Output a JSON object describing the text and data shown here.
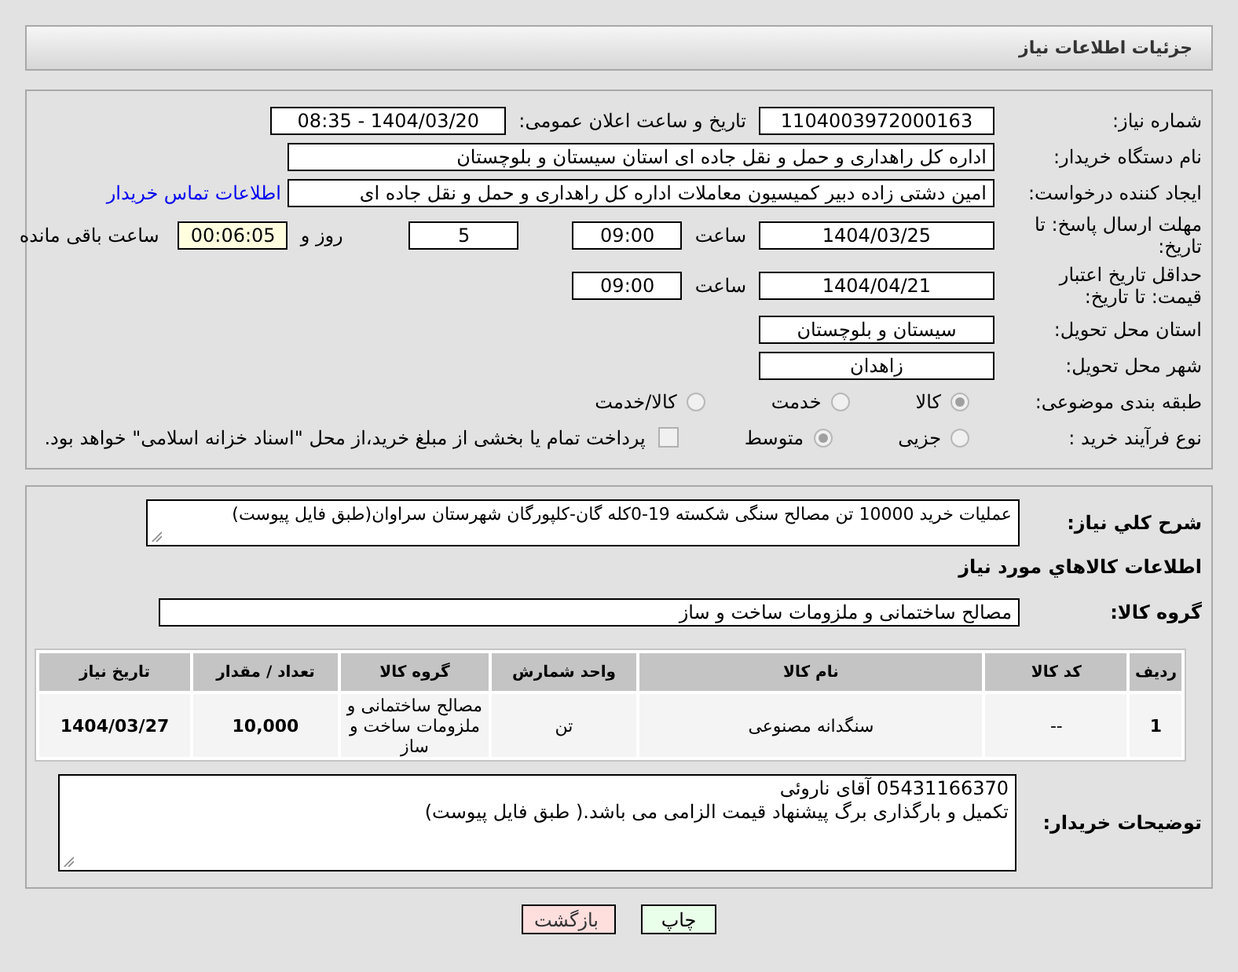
{
  "header": {
    "title": "جزئیات اطلاعات نیاز"
  },
  "details": [
    {
      "label": "شماره نیاز:",
      "items": [
        {
          "kind": "field",
          "value": "1104003972000163"
        },
        {
          "kind": "text",
          "value": "تاریخ و ساعت اعلان عمومی:"
        },
        {
          "kind": "field",
          "value": "1404/03/20 - 08:35"
        }
      ]
    },
    {
      "label": "نام دستگاه خریدار:",
      "items": [
        {
          "kind": "long-field",
          "value": "اداره کل راهداری و حمل و نقل جاده ای استان سیستان و بلوچستان"
        }
      ]
    },
    {
      "label": "ایجاد کننده درخواست:",
      "items": [
        {
          "kind": "long-field",
          "value": "امین دشتی زاده دبیر کمیسیون معاملات اداره کل راهداری و حمل و نقل جاده ای"
        },
        {
          "kind": "link",
          "value": "اطلاعات تماس خریدار"
        }
      ]
    },
    {
      "label": "مهلت ارسال پاسخ: تا تاریخ:",
      "items": [
        {
          "kind": "field",
          "value": "1404/03/25"
        },
        {
          "kind": "text",
          "value": "ساعت"
        },
        {
          "kind": "short-field",
          "value": "09:00"
        },
        {
          "kind": "short-field",
          "value": "5"
        },
        {
          "kind": "text",
          "value": "روز و"
        },
        {
          "kind": "timer-field",
          "value": "00:06:05"
        },
        {
          "kind": "text",
          "value": "ساعت باقی مانده"
        }
      ]
    },
    {
      "label": "حداقل تاریخ اعتبار قیمت: تا تاریخ:",
      "items": [
        {
          "kind": "field",
          "value": "1404/04/21"
        },
        {
          "kind": "text",
          "value": "ساعت"
        },
        {
          "kind": "short-field",
          "value": "09:00"
        }
      ]
    },
    {
      "label": "استان محل تحویل:",
      "items": [
        {
          "kind": "field",
          "value": "سیستان و بلوچستان"
        }
      ]
    },
    {
      "label": "شهر محل تحویل:",
      "items": [
        {
          "kind": "field",
          "value": "زاهدان"
        }
      ]
    },
    {
      "label": "طبقه بندی موضوعی:",
      "items": [
        {
          "kind": "radio",
          "value": "کالا",
          "selected": true
        },
        {
          "kind": "radio",
          "value": "خدمت",
          "selected": false
        },
        {
          "kind": "radio",
          "value": "کالا/خدمت",
          "selected": false
        }
      ]
    },
    {
      "label": "نوع فرآیند خرید :",
      "items": [
        {
          "kind": "radio",
          "value": "جزیی",
          "selected": false
        },
        {
          "kind": "radio",
          "value": "متوسط",
          "selected": true
        },
        {
          "kind": "checkbox",
          "value": "پرداخت تمام یا بخشی از مبلغ خرید،از محل \"اسناد خزانه اسلامی\" خواهد بود.",
          "checked": false
        }
      ]
    }
  ],
  "summary": {
    "label": "شرح کلي نياز:",
    "value": "عملیات خرید 10000 تن مصالح سنگی شکسته 19-0کله گان-کلپورگان شهرستان سراوان(طبق فایل پیوست)"
  },
  "goods_heading": "اطلاعات کالاهاي مورد نياز",
  "goods_group": {
    "label": "گروه کالا:",
    "value": "مصالح ساختمانی و ملزومات ساخت و ساز"
  },
  "table": {
    "columns": [
      "ردیف",
      "کد کالا",
      "نام کالا",
      "واحد شمارش",
      "گروه کالا",
      "تعداد / مقدار",
      "تاریخ نیاز"
    ],
    "rows": [
      [
        "1",
        "--",
        "سنگدانه مصنوعی",
        "تن",
        "مصالح ساختمانی و ملزومات ساخت و ساز",
        "10,000",
        "1404/03/27"
      ]
    ]
  },
  "buyer_notes": {
    "label": "توضیحات خریدار:",
    "value": "05431166370 آقای ناروئی\nتکمیل و بارگذاری برگ پیشنهاد قیمت الزامی می باشد.( طبق فایل پیوست)"
  },
  "buttons": [
    {
      "kind": "print",
      "label": "چاپ"
    },
    {
      "kind": "back",
      "label": "بازگشت"
    }
  ]
}
